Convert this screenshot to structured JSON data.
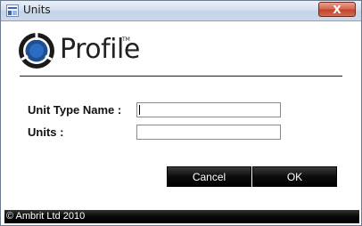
{
  "window": {
    "title": "Units",
    "close_glyph": "X",
    "icon": "app-icon"
  },
  "brand": {
    "name": "Profile",
    "trademark": "TM",
    "logo_icon": "profile-logo-icon",
    "colors": {
      "ring": "#1f4f8f",
      "center": "#2b6cc4",
      "dark": "#1a1a1a"
    }
  },
  "form": {
    "unit_type_name_label": "Unit Type Name :",
    "unit_type_name_value": "",
    "units_label": "Units :",
    "units_value": ""
  },
  "buttons": {
    "cancel": "Cancel",
    "ok": "OK"
  },
  "footer": {
    "copyright": "© Ambrit Ltd 2010"
  }
}
